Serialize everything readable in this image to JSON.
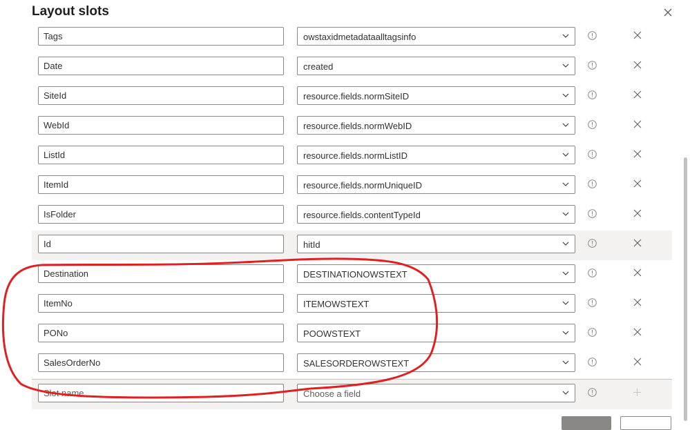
{
  "dialog": {
    "title": "Layout slots"
  },
  "slots": [
    {
      "name": "Tags",
      "field": "owstaxidmetadataalltagsinfo"
    },
    {
      "name": "Date",
      "field": "created"
    },
    {
      "name": "SiteId",
      "field": "resource.fields.normSiteID"
    },
    {
      "name": "WebId",
      "field": "resource.fields.normWebID"
    },
    {
      "name": "ListId",
      "field": "resource.fields.normListID"
    },
    {
      "name": "ItemId",
      "field": "resource.fields.normUniqueID"
    },
    {
      "name": "IsFolder",
      "field": "resource.fields.contentTypeId"
    },
    {
      "name": "Id",
      "field": "hitId"
    },
    {
      "name": "Destination",
      "field": "DESTINATIONOWSTEXT"
    },
    {
      "name": "ItemNo",
      "field": "ITEMOWSTEXT"
    },
    {
      "name": "PONo",
      "field": "POOWSTEXT"
    },
    {
      "name": "SalesOrderNo",
      "field": "SALESORDEROWSTEXT"
    }
  ],
  "new_slot": {
    "name_placeholder": "Slot name",
    "field_placeholder": "Choose a field"
  },
  "colors": {
    "annotation": "#e02020",
    "highlight_row": "#f3f2f1"
  }
}
